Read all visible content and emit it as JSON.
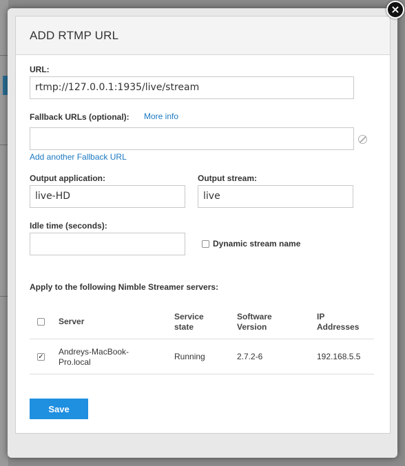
{
  "modal": {
    "title": "ADD RTMP URL",
    "close_glyph": "×"
  },
  "url": {
    "label": "URL:",
    "value": "rtmp://127.0.0.1:1935/live/stream"
  },
  "fallback": {
    "label": "Fallback URLs (optional):",
    "more_info": "More info",
    "value": "",
    "clear_icon": "clear-circle-icon",
    "add_link": "Add another Fallback URL"
  },
  "output_application": {
    "label": "Output application:",
    "value": "live-HD"
  },
  "output_stream": {
    "label": "Output stream:",
    "value": "live"
  },
  "idle_time": {
    "label": "Idle time (seconds):",
    "value": ""
  },
  "dynamic_stream": {
    "label": "Dynamic stream name",
    "checked": false
  },
  "servers": {
    "heading": "Apply to the following Nimble Streamer servers:",
    "columns": [
      "Server",
      "Service state",
      "Software Version",
      "IP Addresses"
    ],
    "header_checkbox_checked": false,
    "rows": [
      {
        "checked": true,
        "server": "Andreys-MacBook-Pro.local",
        "state": "Running",
        "version": "2.7.2-6",
        "ip": "192.168.5.5"
      }
    ]
  },
  "save_label": "Save",
  "colors": {
    "accent": "#1f8fe0",
    "link": "#1a78c2"
  }
}
